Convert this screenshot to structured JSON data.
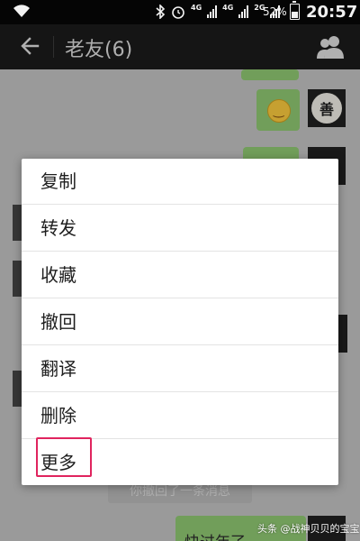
{
  "status_bar": {
    "network_1": "4G",
    "network_2": "4G",
    "network_3": "2G",
    "battery_percent": "52%",
    "time": "20:57"
  },
  "header": {
    "title": "老友(6)"
  },
  "context_menu": {
    "items": [
      "复制",
      "转发",
      "收藏",
      "撤回",
      "翻译",
      "删除",
      "更多"
    ],
    "highlighted_item": "更多"
  },
  "chat": {
    "recall_notice": "你撤回了一条消息",
    "last_message_preview": "快过年了",
    "avatar_char": "善"
  },
  "watermark": "头条 @战神贝贝的宝宝",
  "colors": {
    "highlight": "#e0245e",
    "bubble": "#8ac16e"
  }
}
